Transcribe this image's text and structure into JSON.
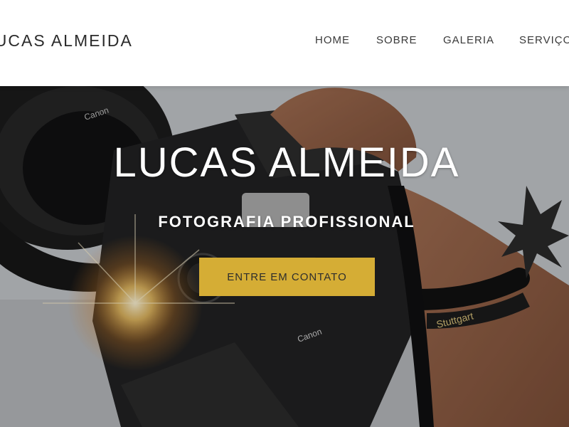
{
  "header": {
    "brand": "LUCAS ALMEIDA",
    "nav": [
      {
        "label": "HOME"
      },
      {
        "label": "SOBRE"
      },
      {
        "label": "GALERIA"
      },
      {
        "label": "SERVIÇOS"
      }
    ]
  },
  "hero": {
    "title": "LUCAS ALMEIDA",
    "subtitle": "FOTOGRAFIA PROFISSIONAL",
    "cta_label": "ENTRE EM CONTATO",
    "camera_brand_text": "Canon",
    "wristband_text": "Stuttgart"
  },
  "colors": {
    "accent": "#d5ad35",
    "header_bg": "#ffffff",
    "header_text": "#2b2b2b",
    "hero_text": "#ffffff"
  }
}
